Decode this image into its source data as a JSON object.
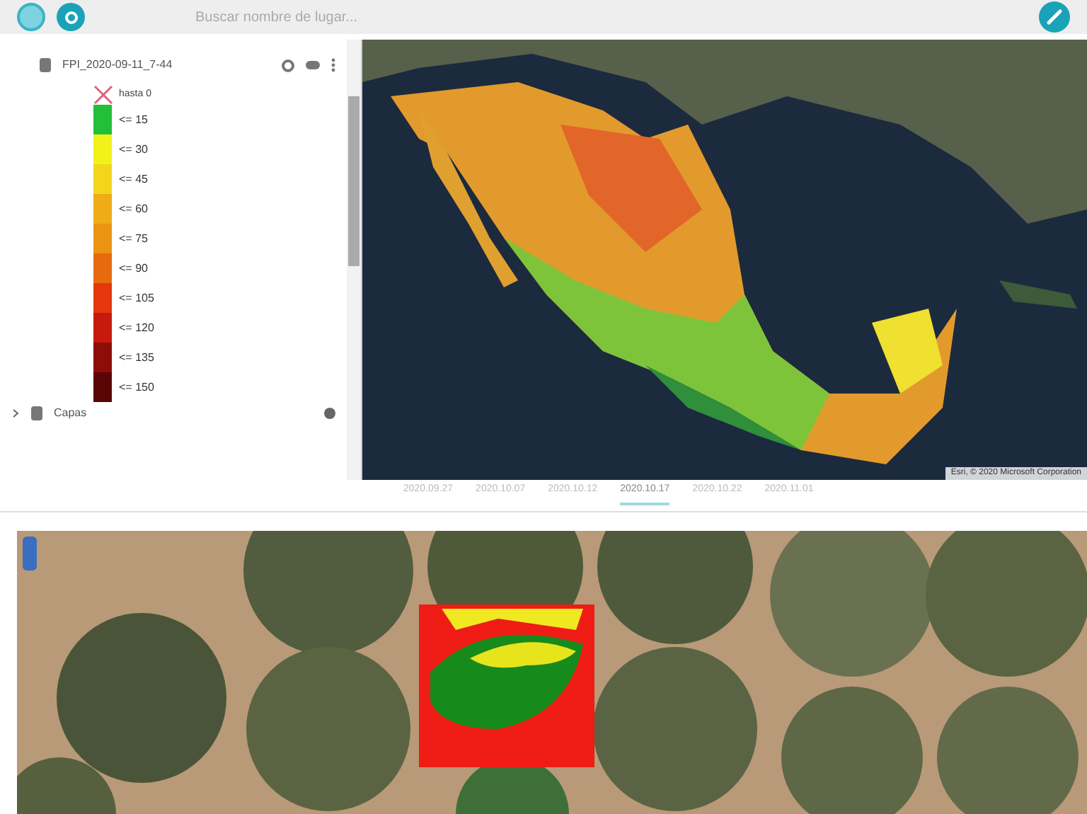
{
  "toolbar": {
    "search": {
      "placeholder": "Buscar nombre de lugar..."
    }
  },
  "layer_panel": {
    "layer": {
      "name": "FPI_2020-09-11_7-44"
    },
    "legend": {
      "nodata": "hasta 0",
      "items": [
        {
          "label": "<= 15",
          "color": "#22c03a"
        },
        {
          "label": "<= 30",
          "color": "#f2f21a"
        },
        {
          "label": "<= 45",
          "color": "#f3d61c"
        },
        {
          "label": "<= 60",
          "color": "#eeac16"
        },
        {
          "label": "<= 75",
          "color": "#eb9312"
        },
        {
          "label": "<= 90",
          "color": "#e86a0e"
        },
        {
          "label": "<= 105",
          "color": "#e5360e"
        },
        {
          "label": "<= 120",
          "color": "#c81a0c"
        },
        {
          "label": "<= 135",
          "color": "#8d0d08"
        },
        {
          "label": "<= 150",
          "color": "#5a0505"
        }
      ]
    },
    "group": {
      "name": "Capas",
      "expanded": false
    }
  },
  "map": {
    "attribution": "Esri, © 2020 Microsoft Corporation"
  },
  "timeline": [
    {
      "label": "2020.09.27",
      "selected": false
    },
    {
      "label": "2020.10.07",
      "selected": false
    },
    {
      "label": "2020.10.12",
      "selected": false
    },
    {
      "label": "2020.10.17",
      "selected": true
    },
    {
      "label": "2020.10.22",
      "selected": false
    },
    {
      "label": "2020.11.01",
      "selected": false
    }
  ]
}
